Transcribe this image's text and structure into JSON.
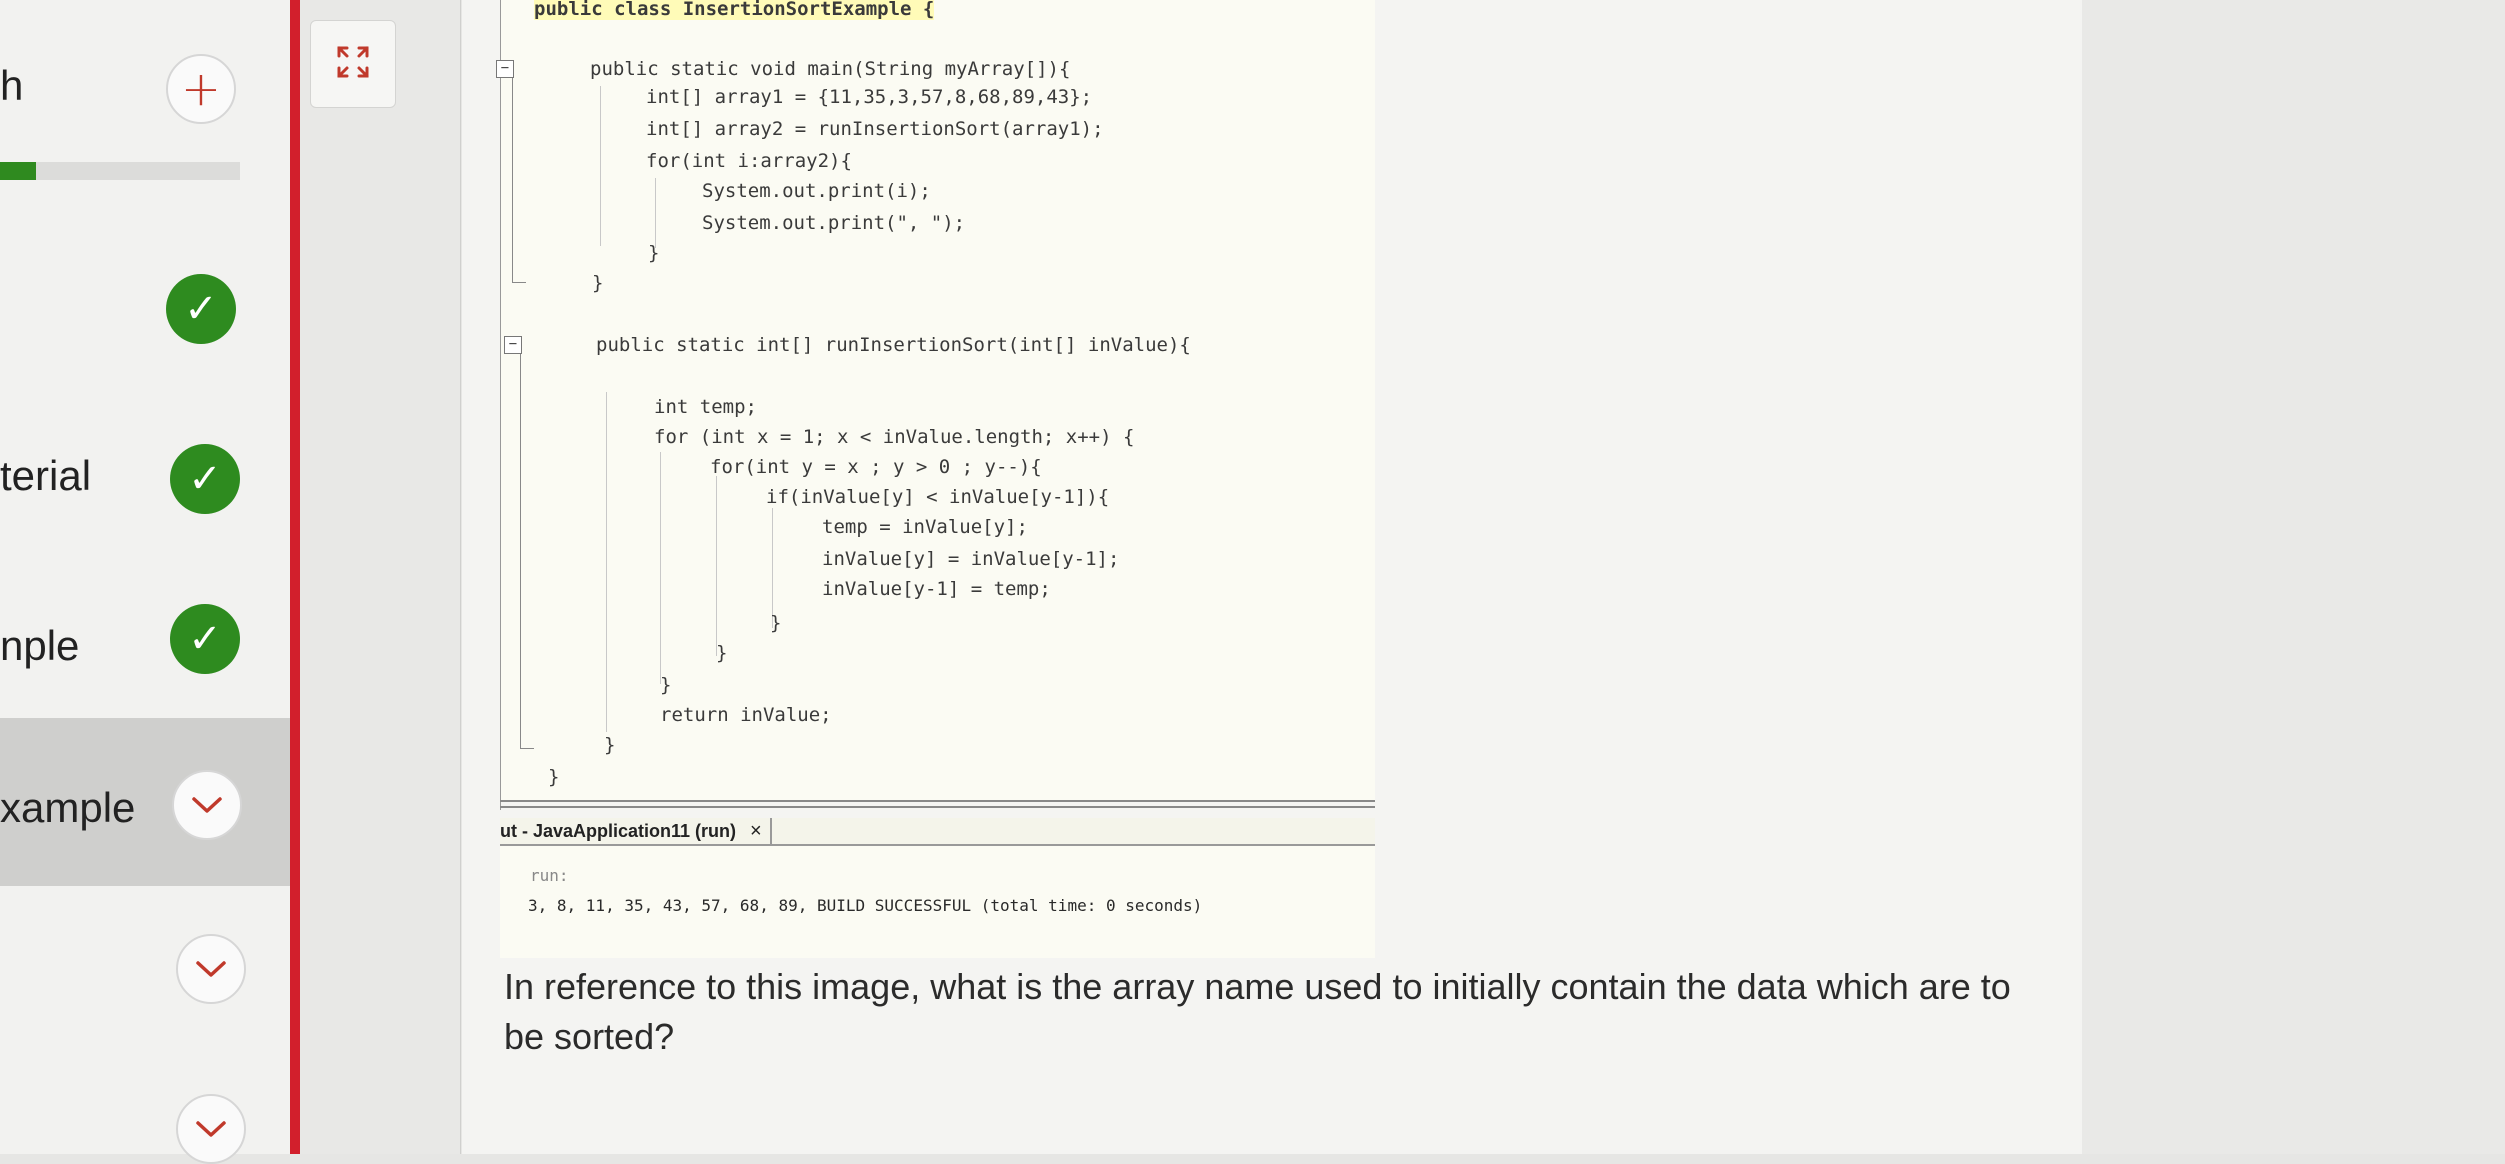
{
  "sidebar": {
    "items": [
      {
        "label": "h",
        "status": "add"
      },
      {
        "label": "",
        "status": "done"
      },
      {
        "label": "terial",
        "status": "done"
      },
      {
        "label": "nple",
        "status": "done"
      },
      {
        "label": "xample",
        "status": "selected"
      },
      {
        "label": "",
        "status": "collapsed"
      },
      {
        "label": "",
        "status": "collapsed"
      }
    ],
    "progress_percent": 15,
    "icons": {
      "add": "plus-icon",
      "done": "check-icon",
      "expand": "chevron-down-icon"
    }
  },
  "toolbar": {
    "expand_icon": "expand-icon"
  },
  "code": {
    "lines": [
      "public class InsertionSortExample {",
      "public static void main(String myArray[]){",
      "int[] array1 = {11,35,3,57,8,68,89,43};",
      "int[] array2 = runInsertionSort(array1);",
      "for(int i:array2){",
      "System.out.print(i);",
      "System.out.print(\", \");",
      "}",
      "}",
      "public static int[] runInsertionSort(int[] inValue){",
      "int temp;",
      "for (int x = 1; x < inValue.length; x++) {",
      "for(int y = x ; y > 0 ; y--){",
      "if(inValue[y] < inValue[y-1]){",
      "temp = inValue[y];",
      "inValue[y] = inValue[y-1];",
      "inValue[y-1] = temp;",
      "}",
      "}",
      "}",
      "return inValue;",
      "}",
      "}"
    ]
  },
  "output": {
    "tab_title": "ut - JavaApplication11 (run)",
    "close_label": "×",
    "run_label": "run:",
    "result_line": "3, 8, 11, 35, 43, 57, 68, 89, BUILD SUCCESSFUL (total time: 0 seconds)"
  },
  "question": {
    "text": "In reference to this image, what is the array name used to initially contain the data which are to be sorted?"
  },
  "colors": {
    "accent_red": "#d21f2c",
    "check_green": "#2e8b1f",
    "build_success_green": "#3b8a2e",
    "highlight_yellow": "#fffbb8"
  }
}
